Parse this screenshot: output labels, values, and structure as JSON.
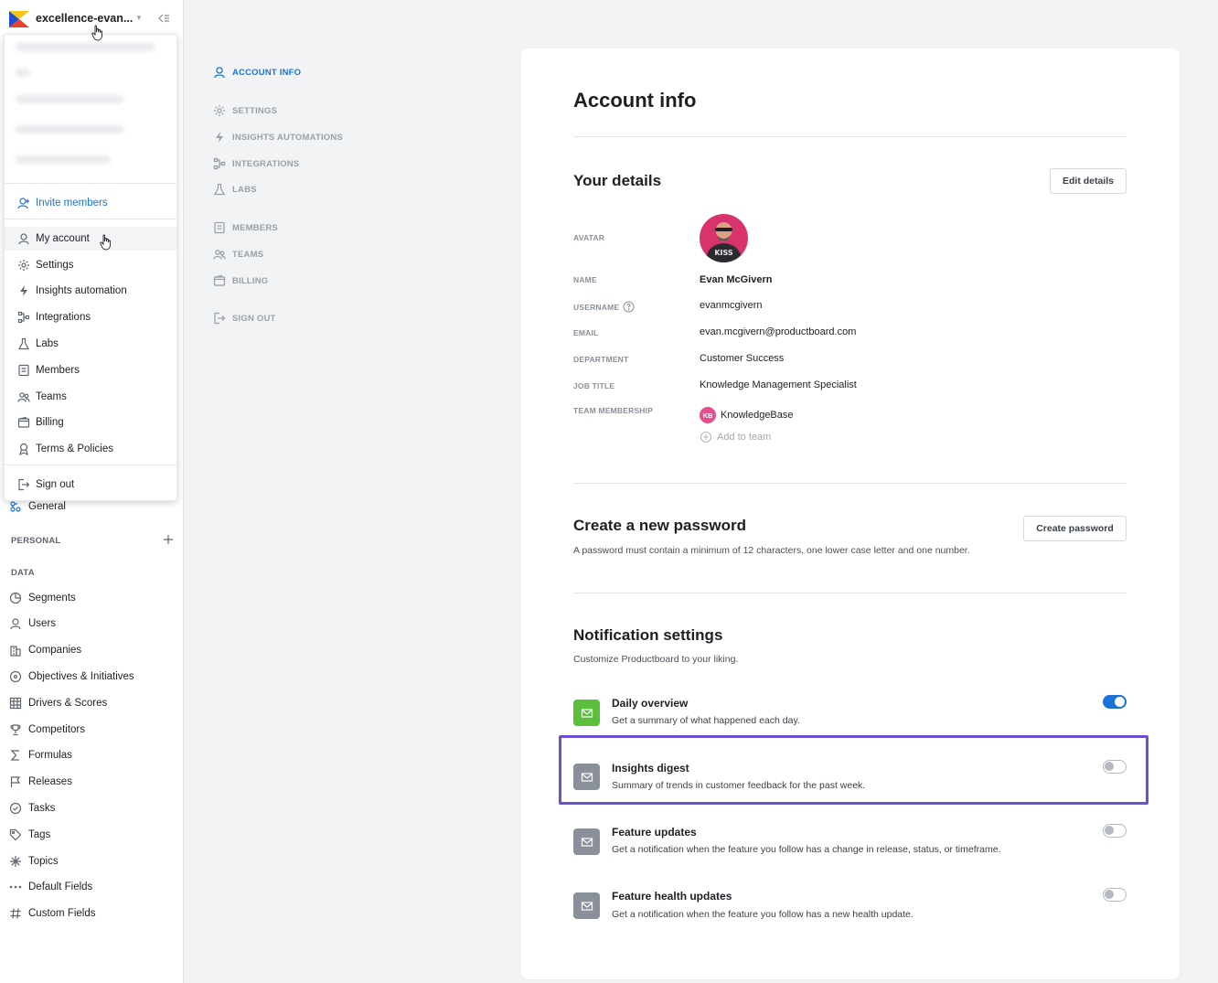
{
  "workspace": {
    "name": "excellence-evan..."
  },
  "sidebar": {
    "general_label": "General",
    "personal_label": "PERSONAL",
    "data_label": "DATA",
    "items": [
      {
        "label": "Segments"
      },
      {
        "label": "Users"
      },
      {
        "label": "Companies"
      },
      {
        "label": "Objectives & Initiatives"
      },
      {
        "label": "Drivers & Scores"
      },
      {
        "label": "Competitors"
      },
      {
        "label": "Formulas"
      },
      {
        "label": "Releases"
      },
      {
        "label": "Tasks"
      },
      {
        "label": "Tags"
      },
      {
        "label": "Topics"
      },
      {
        "label": "Default Fields"
      },
      {
        "label": "Custom Fields"
      }
    ]
  },
  "menu": {
    "invite_label": "Invite members",
    "items": [
      {
        "label": "My account"
      },
      {
        "label": "Settings"
      },
      {
        "label": "Insights automation"
      },
      {
        "label": "Integrations"
      },
      {
        "label": "Labs"
      },
      {
        "label": "Members"
      },
      {
        "label": "Teams"
      },
      {
        "label": "Billing"
      },
      {
        "label": "Terms & Policies"
      }
    ],
    "signout_label": "Sign out"
  },
  "settings_nav": {
    "items": [
      {
        "label": "ACCOUNT INFO",
        "active": true
      },
      {
        "label": "SETTINGS"
      },
      {
        "label": "INSIGHTS AUTOMATIONS"
      },
      {
        "label": "INTEGRATIONS"
      },
      {
        "label": "LABS"
      },
      {
        "label": "MEMBERS"
      },
      {
        "label": "TEAMS"
      },
      {
        "label": "BILLING"
      },
      {
        "label": "SIGN OUT"
      }
    ]
  },
  "account": {
    "title": "Account info",
    "details_heading": "Your details",
    "edit_button": "Edit details",
    "labels": {
      "avatar": "AVATAR",
      "name": "NAME",
      "username": "USERNAME",
      "email": "EMAIL",
      "department": "DEPARTMENT",
      "job_title": "JOB TITLE",
      "team_membership": "TEAM MEMBERSHIP"
    },
    "values": {
      "name": "Evan McGivern",
      "username": "evanmcgivern",
      "email": "evan.mcgivern@productboard.com",
      "department": "Customer Success",
      "job_title": "Knowledge Management Specialist"
    },
    "team": {
      "initials": "KB",
      "name": "KnowledgeBase",
      "add_label": "Add to team"
    },
    "avatar_text": "KISS"
  },
  "password": {
    "heading": "Create a new password",
    "button": "Create password",
    "description": "A password must contain a minimum of 12 characters, one lower case letter and one number."
  },
  "notifications": {
    "heading": "Notification settings",
    "description": "Customize Productboard to your liking.",
    "items": [
      {
        "title": "Daily overview",
        "description": "Get a summary of what happened each day.",
        "enabled": true,
        "icon_color": "#5cbf3c"
      },
      {
        "title": "Insights digest",
        "description": "Summary of trends in customer feedback for the past week.",
        "enabled": false,
        "icon_color": "#8a9099"
      },
      {
        "title": "Feature updates",
        "description": "Get a notification when the feature you follow has a change in release, status, or timeframe.",
        "enabled": false,
        "icon_color": "#8a9099"
      },
      {
        "title": "Feature health updates",
        "description": "Get a notification when the feature you follow has a new health update.",
        "enabled": false,
        "icon_color": "#8a9099"
      }
    ]
  },
  "colors": {
    "accent": "#1a73d9",
    "highlight": "#6e4fd0"
  }
}
